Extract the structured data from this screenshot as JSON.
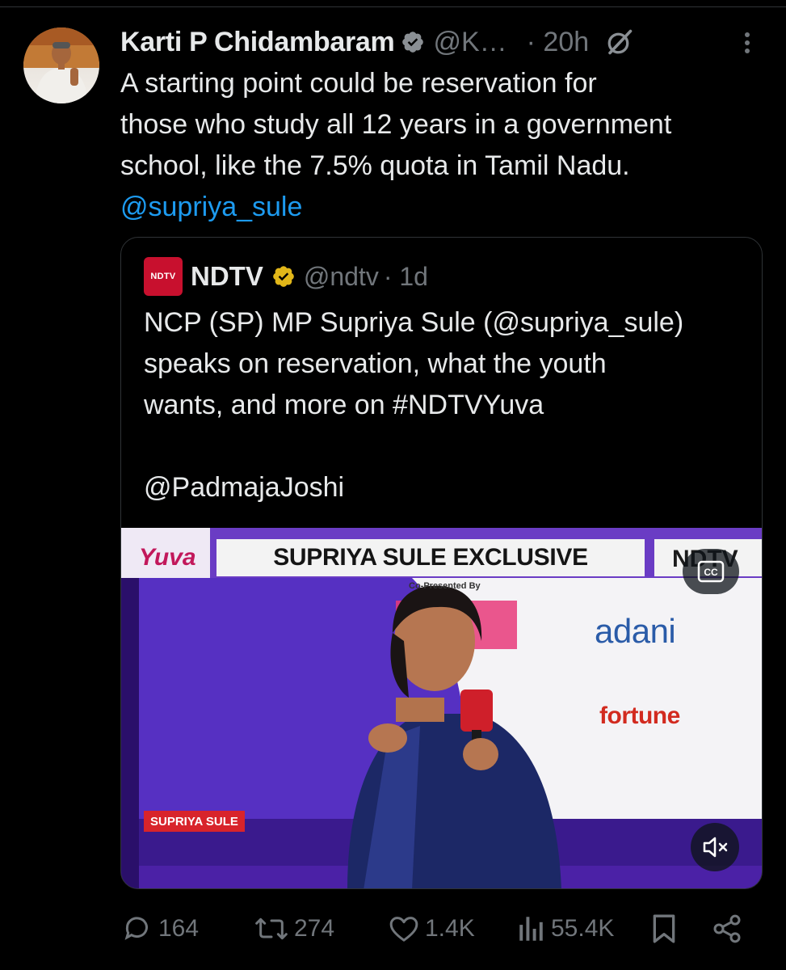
{
  "tweet": {
    "author_name": "Karti P Chidambaram",
    "handle": "@K…",
    "time": "· 20h",
    "text_lines": [
      "A starting point could be reservation for",
      "those who study all 12 years in a government",
      "school, like the 7.5% quota in Tamil Nadu."
    ],
    "mention": "@supriya_sule"
  },
  "quote": {
    "logo_text": "NDTV",
    "author_name": "NDTV",
    "handle": "@ndtv",
    "time": "· 1d",
    "text": "NCP (SP) MP Supriya Sule (@supriya_sule)\nspeaks on reservation, what the youth\nwants, and more on #NDTVYuva\n\n@PadmajaJoshi",
    "video": {
      "banner_title": "SUPRIYA SULE EXCLUSIVE",
      "co_presented": "Co-Presented By",
      "name_strip": "SUPRIYA SULE",
      "brand_1": "adani",
      "brand_2": "fortune",
      "cc_label": "CC",
      "accent_color": "#5b28b9"
    }
  },
  "actions": {
    "replies": "164",
    "reposts": "274",
    "likes": "1.4K",
    "views": "55.4K"
  },
  "icons": [
    "verified-badge-icon",
    "grok-icon",
    "more-icon",
    "cc-icon",
    "mute-icon",
    "reply-icon",
    "repost-icon",
    "like-icon",
    "views-icon",
    "bookmark-icon",
    "share-icon"
  ],
  "colors": {
    "background": "#000000",
    "text": "#e7e9ea",
    "muted": "#71767b",
    "link": "#1d9bf0",
    "verified_blue": "#1d9bf0",
    "verified_gold": "#e2b719"
  }
}
